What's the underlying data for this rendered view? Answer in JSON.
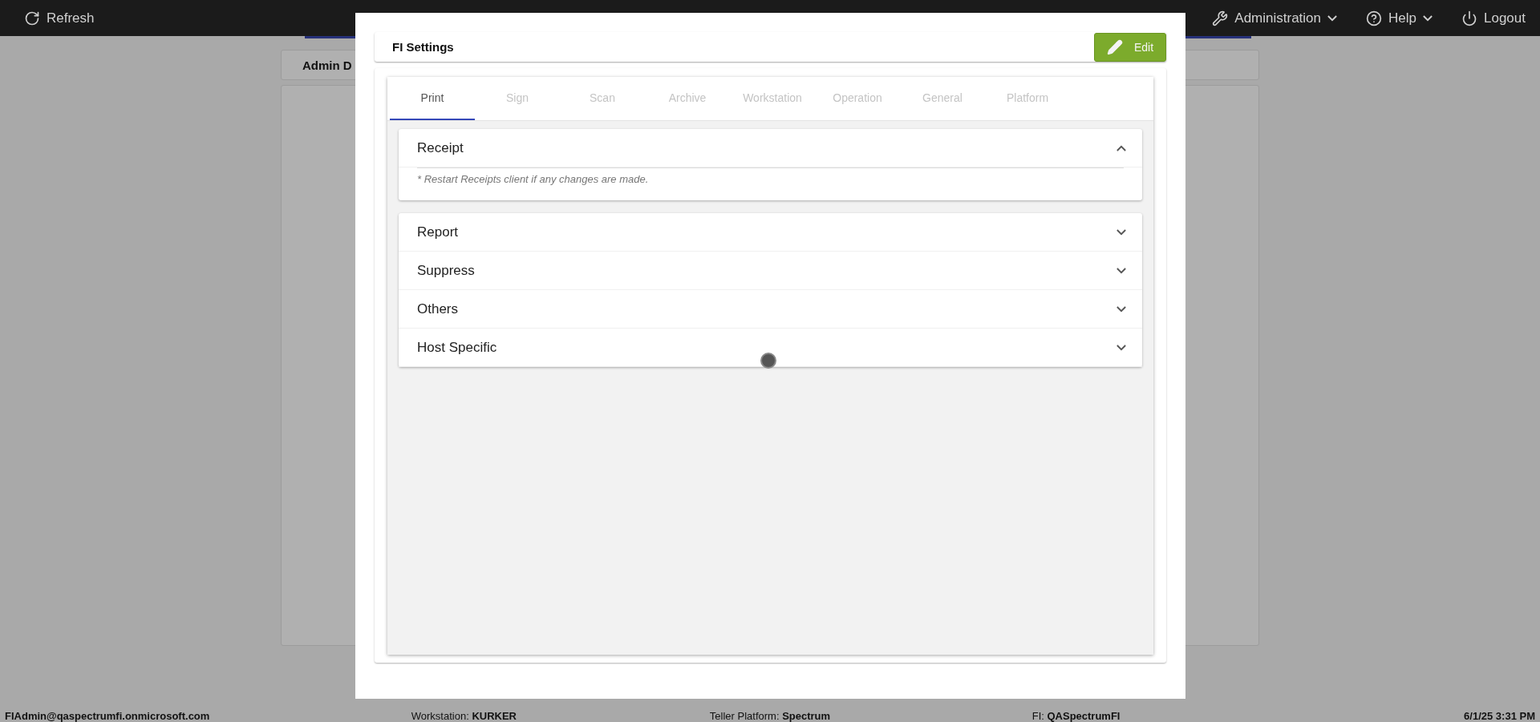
{
  "top_bar": {
    "left": [
      {
        "kind": "refresh",
        "label": "Refresh"
      }
    ],
    "right": [
      {
        "kind": "wrench",
        "label": "Administration",
        "dropdown": true
      },
      {
        "kind": "help",
        "label": "Help",
        "dropdown": true
      },
      {
        "kind": "power",
        "label": "Logout",
        "dropdown": false
      }
    ]
  },
  "background": {
    "card_title": "Admin D"
  },
  "dialog": {
    "title": "FI Settings",
    "edit_button": "Edit",
    "tabs": [
      {
        "label": "Print",
        "selected": true
      },
      {
        "label": "Sign",
        "selected": false
      },
      {
        "label": "Scan",
        "selected": false
      },
      {
        "label": "Archive",
        "selected": false
      },
      {
        "label": "Workstation",
        "selected": false
      },
      {
        "label": "Operation",
        "selected": false
      },
      {
        "label": "General",
        "selected": false
      },
      {
        "label": "Platform",
        "selected": false
      }
    ],
    "sections": [
      {
        "title": "Receipt",
        "expanded": true,
        "note": "* Restart Receipts client if any changes are made."
      },
      {
        "title": "Report",
        "expanded": false
      },
      {
        "title": "Suppress",
        "expanded": false
      },
      {
        "title": "Others",
        "expanded": false
      },
      {
        "title": "Host Specific",
        "expanded": false
      }
    ]
  },
  "status_bar": [
    "**FIAdmin@qaspectrumfi.onmicrosoft.com**",
    "Workstation: **KURKER**",
    "Teller Platform: **Spectrum**",
    "FI: **QASpectrumFI**",
    "**6/1/25 3:31 PM**"
  ]
}
